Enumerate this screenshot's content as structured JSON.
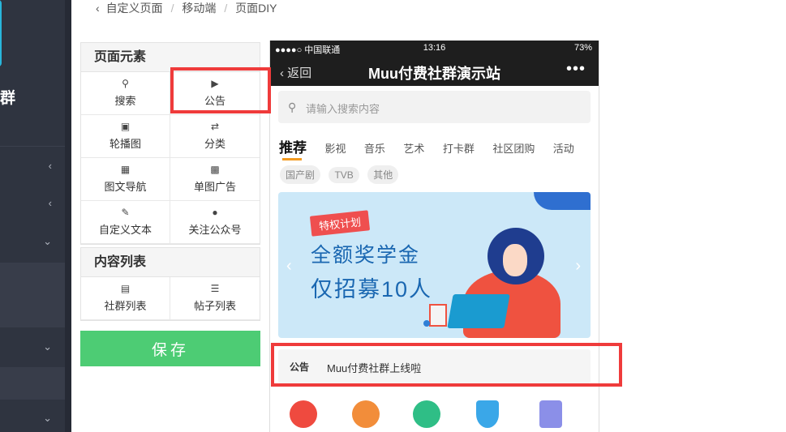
{
  "sidebar": {
    "brand": "群",
    "chevrons": [
      "‹",
      "‹",
      "⌄",
      "⌄",
      "⌄"
    ]
  },
  "breadcrumb": {
    "items": [
      "自定义页面",
      "移动端",
      "页面DIY"
    ]
  },
  "elements_panel": {
    "title": "页面元素",
    "items": [
      {
        "label": "搜索",
        "icon": "search-icon"
      },
      {
        "label": "公告",
        "icon": "megaphone-icon"
      },
      {
        "label": "轮播图",
        "icon": "slides-icon"
      },
      {
        "label": "分类",
        "icon": "swap-icon"
      },
      {
        "label": "图文导航",
        "icon": "grid-icon"
      },
      {
        "label": "单图广告",
        "icon": "image-icon"
      },
      {
        "label": "自定义文本",
        "icon": "edit-icon"
      },
      {
        "label": "关注公众号",
        "icon": "wechat-icon"
      }
    ]
  },
  "content_panel": {
    "title": "内容列表",
    "items": [
      {
        "label": "社群列表",
        "icon": "list-icon"
      },
      {
        "label": "帖子列表",
        "icon": "list-bullet-icon"
      }
    ]
  },
  "save_button": "保存",
  "phone": {
    "status": {
      "carrier": "●●●●○ 中国联通",
      "time": "13:16",
      "battery": "73%"
    },
    "nav": {
      "back": "返回",
      "title": "Muu付费社群演示站",
      "more": "•••"
    },
    "search_placeholder": "请输入搜索内容",
    "tabs": [
      "推荐",
      "影视",
      "音乐",
      "艺术",
      "打卡群",
      "社区团购",
      "活动"
    ],
    "subtags": [
      "国产剧",
      "TVB",
      "其他"
    ],
    "banner": {
      "tag": "特权计划",
      "line1": "全额奖学金",
      "line2": "仅招募10人"
    },
    "notice": {
      "label": "公告",
      "text": "Muu付费社群上线啦"
    },
    "icon_colors": [
      "#ef4a3f",
      "#f28d3a",
      "#2fbe86",
      "#3aa7e8",
      "#8b8fe8"
    ]
  },
  "colors": {
    "save": "#4dcc74",
    "highlight": "#ef3b3b",
    "sidebar": "#2f3440"
  }
}
